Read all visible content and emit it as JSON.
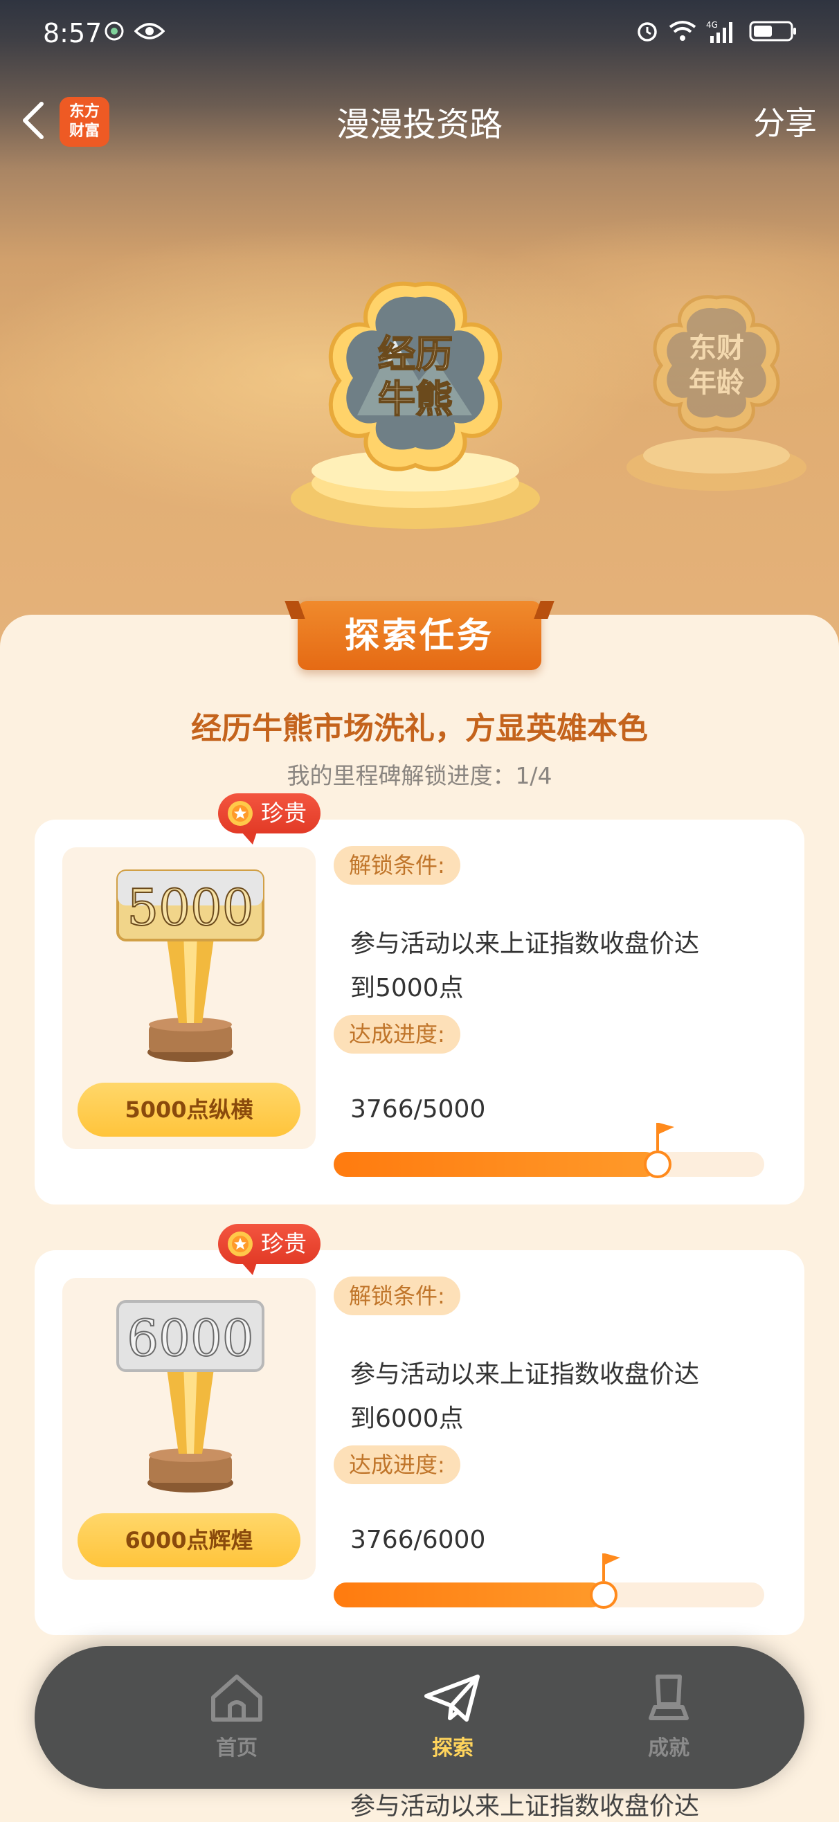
{
  "status_bar": {
    "time": "8:57"
  },
  "nav": {
    "logo_line1": "东方",
    "logo_line2": "财富",
    "title": "漫漫投资路",
    "share_label": "分享"
  },
  "badges": {
    "main_line1": "经历",
    "main_line2": "牛熊",
    "side_line1": "东财",
    "side_line2": "年龄"
  },
  "section": {
    "ribbon_label": "探索任务",
    "headline": "经历牛熊市场洗礼，方显英雄本色",
    "progress_text": "我的里程碑解锁进度：1/4"
  },
  "cards": [
    {
      "tag": "珍贵",
      "trophy_number": "5000",
      "trophy_name": "5000点纵横",
      "condition_label": "解锁条件:",
      "condition_line1": "参与活动以来上证指数收盘价达",
      "condition_line2": "到5000点",
      "progress_label": "达成进度:",
      "progress_value": "3766/5000",
      "progress_fraction": 0.7532
    },
    {
      "tag": "珍贵",
      "trophy_number": "6000",
      "trophy_name": "6000点辉煌",
      "condition_label": "解锁条件:",
      "condition_line1": "参与活动以来上证指数收盘价达",
      "condition_line2": "到6000点",
      "progress_label": "达成进度:",
      "progress_value": "3766/6000",
      "progress_fraction": 0.6277
    }
  ],
  "peek_text": "参与活动以来上证指数收盘价达",
  "tabbar": {
    "home": "首页",
    "explore": "探索",
    "achievement": "成就"
  },
  "colors": {
    "accent_orange": "#ff7b0f",
    "headline_brown": "#c4631c",
    "active_tab": "#ffd45c"
  }
}
